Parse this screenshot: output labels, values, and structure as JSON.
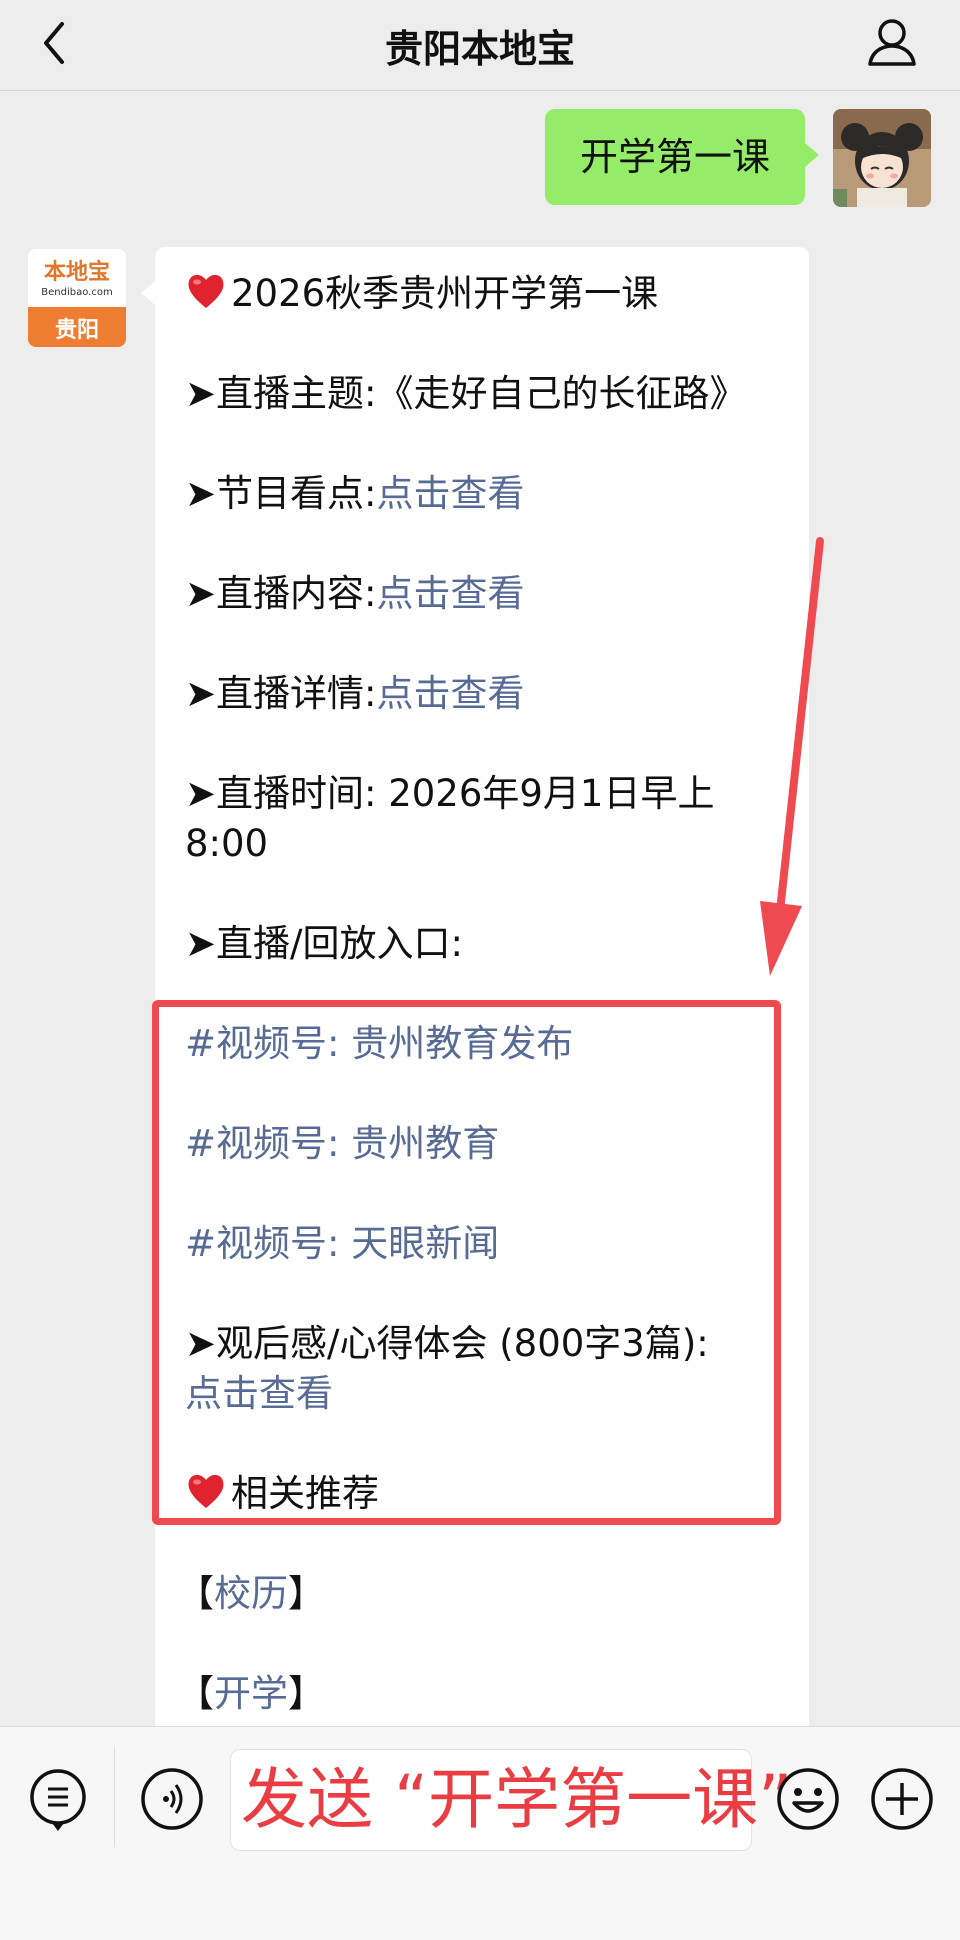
{
  "header": {
    "title": "贵阳本地宝"
  },
  "my_message": {
    "text": "开学第一课"
  },
  "bot": {
    "avatar_text_top": "本地宝",
    "avatar_text_mid": "Bendibao.com",
    "avatar_text_bottom": "贵阳",
    "message": {
      "headline": "2026秋季贵州开学第一课",
      "theme_label": "➤直播主题:",
      "theme_value": "《走好自己的长征路》",
      "highlights_label": "➤节目看点:",
      "highlights_link": "点击查看",
      "content_label": "➤直播内容:",
      "content_link": "点击查看",
      "details_label": "➤直播详情:",
      "details_link": "点击查看",
      "time_label": "➤直播时间: 2026年9月1日早上",
      "time_value": "8:00",
      "entry_label": "➤直播/回放入口:",
      "channels": [
        "#视频号: 贵州教育发布",
        "#视频号: 贵州教育",
        "#视频号: 天眼新闻"
      ],
      "review_label": "➤观后感/心得体会 (800字3篇):",
      "review_link": "点击查看",
      "related_title": "相关推荐",
      "related_items": [
        {
          "open": "【",
          "label": "校历",
          "close": "】"
        },
        {
          "open": "【",
          "label": "开学",
          "close": "】"
        }
      ]
    }
  },
  "input": {
    "text": "发送 “开学第一课”"
  },
  "colors": {
    "link": "#576b95",
    "highlight_box": "#ee4a50",
    "my_bubble": "#95ec69"
  }
}
